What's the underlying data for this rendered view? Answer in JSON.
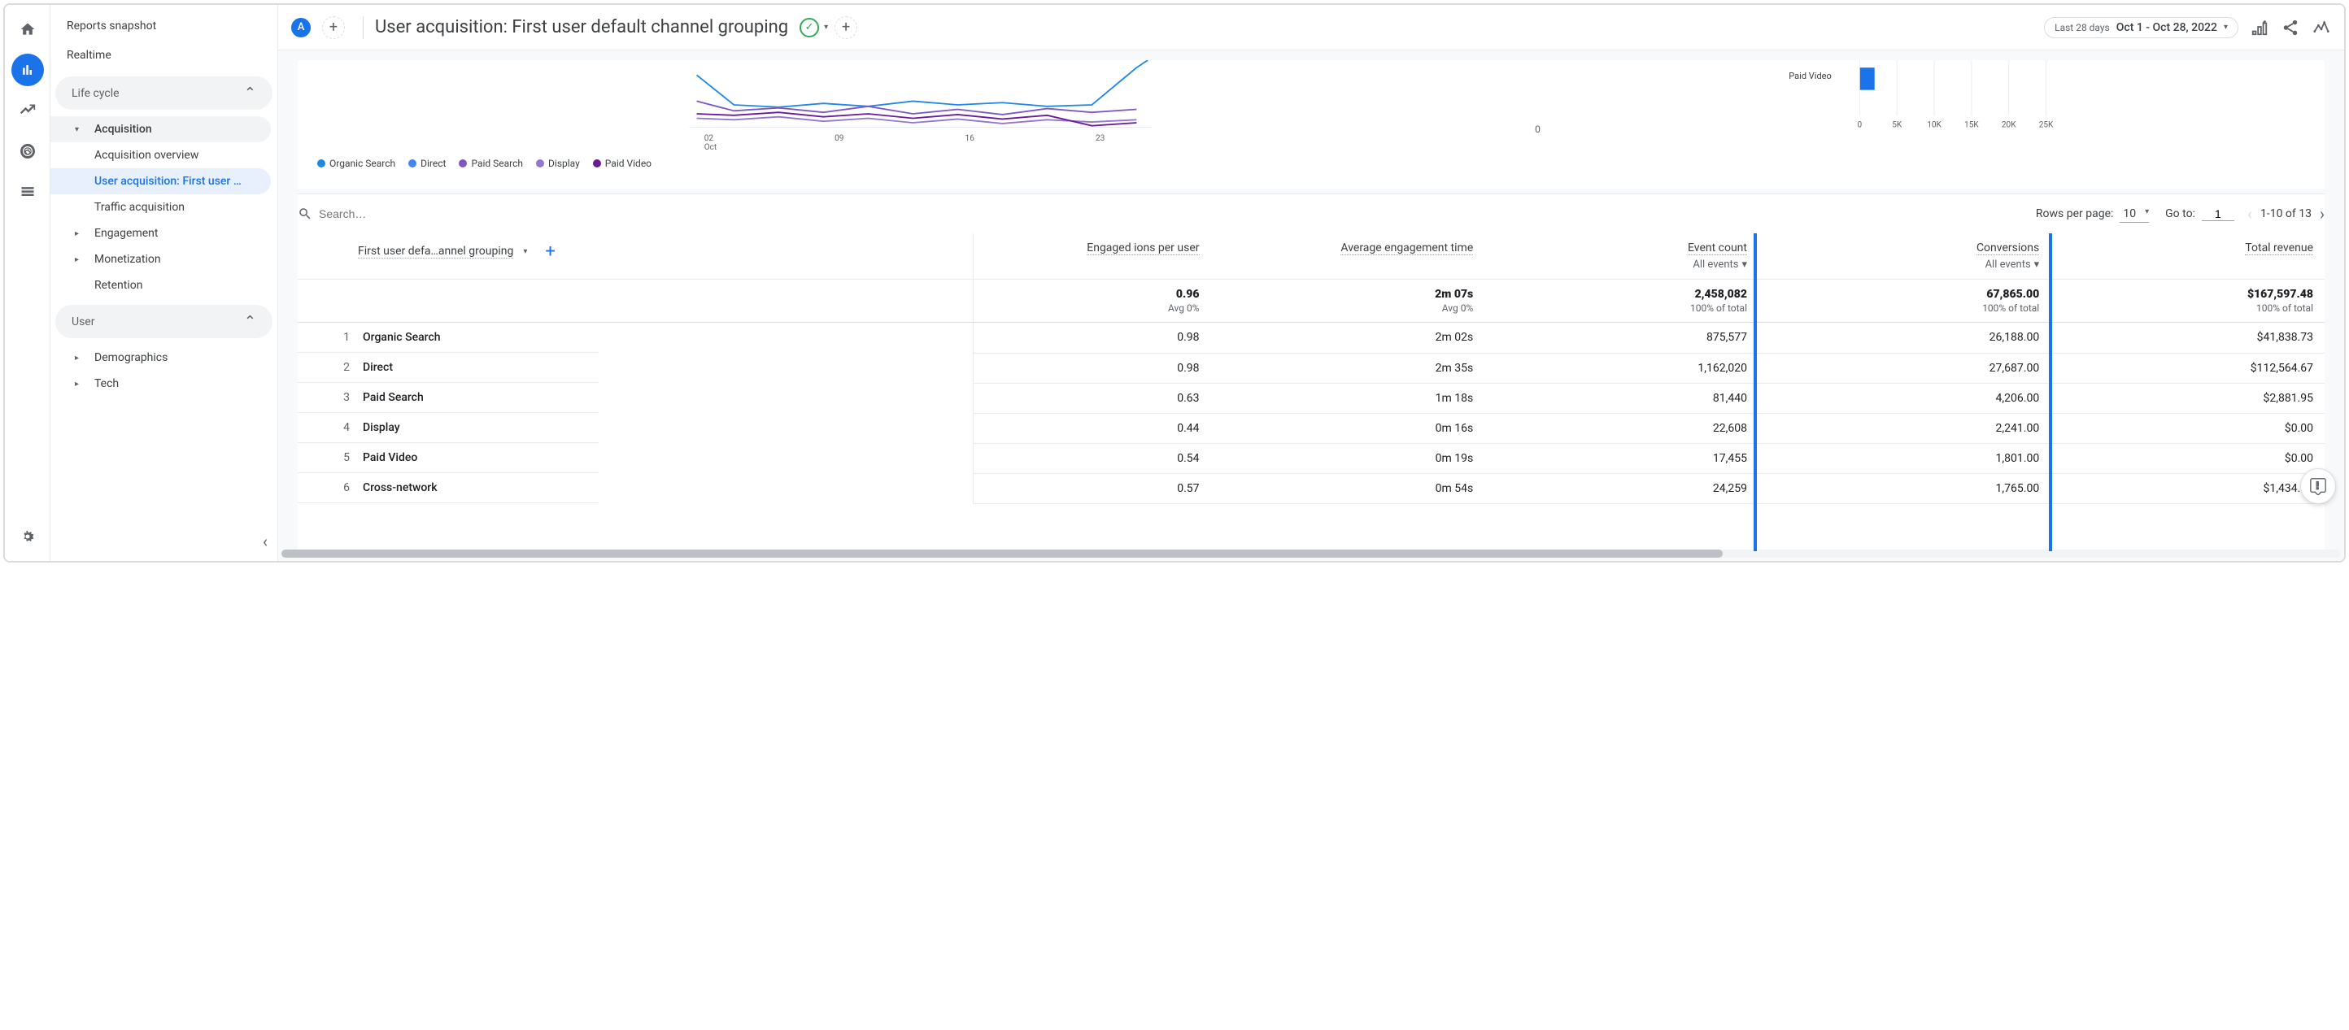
{
  "rail": {
    "icons": [
      "home",
      "reports",
      "explore",
      "advertising",
      "configure"
    ]
  },
  "sidebar": {
    "snapshot": "Reports snapshot",
    "realtime": "Realtime",
    "sections": {
      "life_cycle": {
        "label": "Life cycle",
        "acquisition": {
          "label": "Acquisition",
          "items": [
            "Acquisition overview",
            "User acquisition: First user …",
            "Traffic acquisition"
          ]
        },
        "engagement": "Engagement",
        "monetization": "Monetization",
        "retention": "Retention"
      },
      "user": {
        "label": "User",
        "demographics": "Demographics",
        "tech": "Tech"
      }
    }
  },
  "header": {
    "avatar_letter": "A",
    "title": "User acquisition: First user default channel grouping",
    "date_label": "Last 28 days",
    "date_value": "Oct 1 - Oct 28, 2022"
  },
  "chart_data": {
    "line": {
      "type": "line",
      "x_ticks": [
        "02",
        "09",
        "16",
        "23"
      ],
      "x_sublabel": "Oct",
      "y_tick": "0",
      "series": [
        {
          "name": "Organic Search",
          "color": "#1e88e5"
        },
        {
          "name": "Direct",
          "color": "#4285f4"
        },
        {
          "name": "Paid Search",
          "color": "#7e57c2"
        },
        {
          "name": "Display",
          "color": "#9575cd"
        },
        {
          "name": "Paid Video",
          "color": "#6a1b9a"
        }
      ]
    },
    "bar": {
      "type": "bar",
      "categories": [
        "Paid Video"
      ],
      "values": [
        2000
      ],
      "xlim": [
        0,
        25000
      ],
      "x_ticks": [
        "0",
        "5K",
        "10K",
        "15K",
        "20K",
        "25K"
      ],
      "color": "#1a73e8"
    }
  },
  "table_controls": {
    "search_placeholder": "Search…",
    "rows_per_page_label": "Rows per page:",
    "rows_per_page_value": "10",
    "goto_label": "Go to:",
    "goto_value": "1",
    "pager_text": "1-10 of 13"
  },
  "table": {
    "dim_header": "First user defa…annel grouping",
    "columns": [
      {
        "label": "Engaged ions per user",
        "sub": ""
      },
      {
        "label": "Average engagement time",
        "sub": ""
      },
      {
        "label": "Event count",
        "sub": "All events"
      },
      {
        "label": "Conversions",
        "sub": "All events"
      },
      {
        "label": "Total revenue",
        "sub": ""
      }
    ],
    "totals": {
      "values": [
        "0.96",
        "2m 07s",
        "2,458,082",
        "67,865.00",
        "$167,597.48"
      ],
      "subs": [
        "Avg 0%",
        "Avg 0%",
        "100% of total",
        "100% of total",
        "100% of total"
      ]
    },
    "rows": [
      {
        "idx": "1",
        "name": "Organic Search",
        "v": [
          "0.98",
          "2m 02s",
          "875,577",
          "26,188.00",
          "$41,838.73"
        ]
      },
      {
        "idx": "2",
        "name": "Direct",
        "v": [
          "0.98",
          "2m 35s",
          "1,162,020",
          "27,687.00",
          "$112,564.67"
        ]
      },
      {
        "idx": "3",
        "name": "Paid Search",
        "v": [
          "0.63",
          "1m 18s",
          "81,440",
          "4,206.00",
          "$2,881.95"
        ]
      },
      {
        "idx": "4",
        "name": "Display",
        "v": [
          "0.44",
          "0m 16s",
          "22,608",
          "2,241.00",
          "$0.00"
        ]
      },
      {
        "idx": "5",
        "name": "Paid Video",
        "v": [
          "0.54",
          "0m 19s",
          "17,455",
          "1,801.00",
          "$0.00"
        ]
      },
      {
        "idx": "6",
        "name": "Cross-network",
        "v": [
          "0.57",
          "0m 54s",
          "24,259",
          "1,765.00",
          "$1,434.90"
        ]
      }
    ]
  }
}
